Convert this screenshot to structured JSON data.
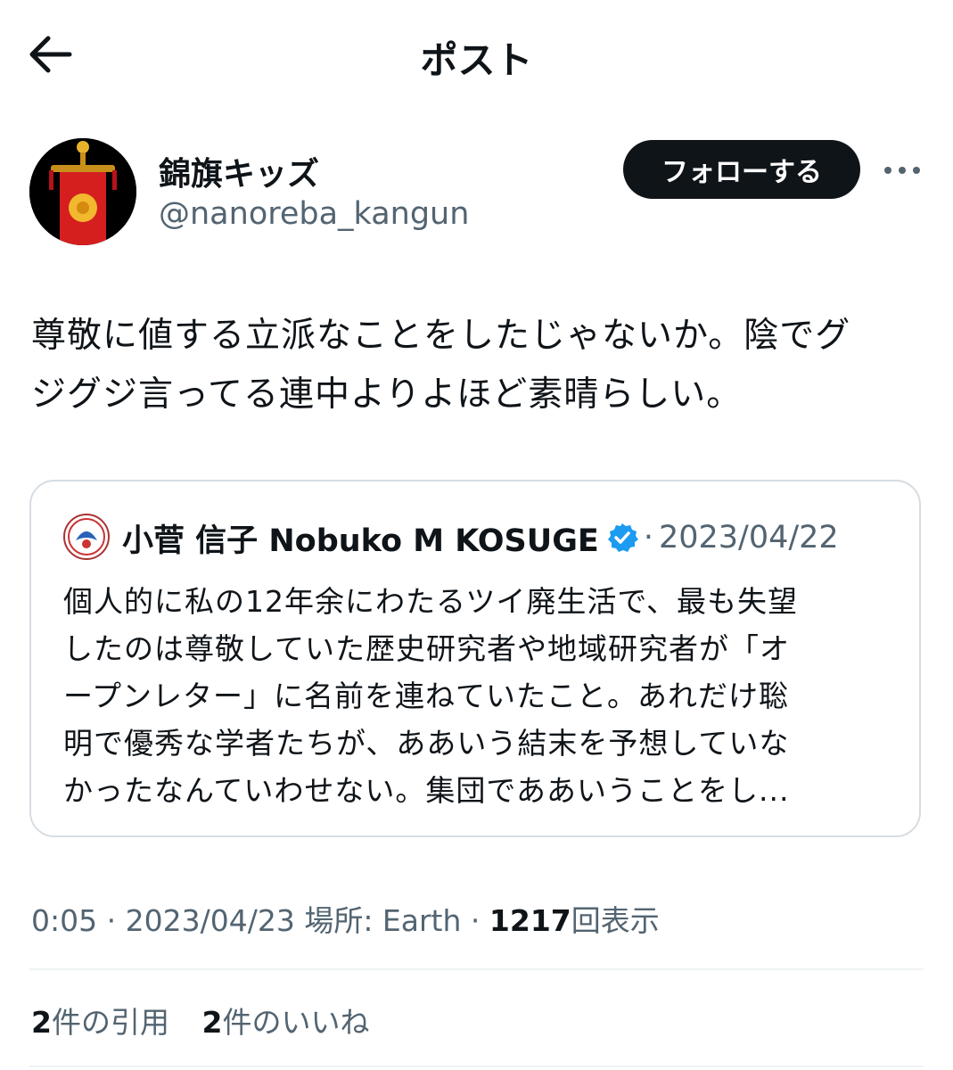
{
  "header": {
    "title": "ポスト"
  },
  "author": {
    "display_name": "錦旗キッズ",
    "handle": "@nanoreba_kangun",
    "follow_label": "フォローする"
  },
  "post": {
    "text_line1": "尊敬に値する立派なことをしたじゃないか。陰でグ",
    "text_line2": "ジグジ言ってる連中よりよほど素晴らしい。"
  },
  "quote": {
    "name": "小菅 信子 Nobuko M KOSUGE",
    "separator": "·",
    "date": "2023/04/22",
    "lines": [
      "個人的に私の12年余にわたるツイ廃生活で、最も失望",
      "したのは尊敬していた歴史研究者や地域研究者が「オ",
      "ープンレター」に名前を連ねていたこと。あれだけ聡",
      "明で優秀な学者たちが、ああいう結末を予想していな",
      "かったなんていわせない。集団でああいうことをし..."
    ]
  },
  "meta": {
    "time": "0:05",
    "sep": "·",
    "date": "2023/04/23",
    "location_label": "場所: Earth",
    "views_count": "1217",
    "views_label": "回表示"
  },
  "stats": {
    "quotes_count": "2",
    "quotes_label": "件の引用",
    "likes_count": "2",
    "likes_label": "件のいいね"
  },
  "colors": {
    "text": "#0f1419",
    "secondary": "#536471",
    "verified": "#1d9bf0",
    "border": "#d6dde2"
  }
}
